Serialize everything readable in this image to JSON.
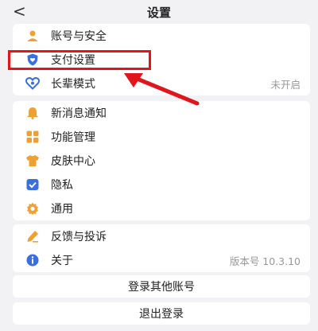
{
  "header": {
    "back_glyph": "<",
    "title": "设置"
  },
  "groups": [
    {
      "items": [
        {
          "name": "account-security",
          "icon": "person-icon",
          "label": "账号与安全",
          "value": ""
        },
        {
          "name": "payment-settings",
          "icon": "shield-heart-icon",
          "label": "支付设置",
          "value": ""
        },
        {
          "name": "elder-mode",
          "icon": "heart-link-icon",
          "label": "长辈模式",
          "value": "未开启"
        }
      ]
    },
    {
      "items": [
        {
          "name": "new-message-notify",
          "icon": "bell-icon",
          "label": "新消息通知",
          "value": ""
        },
        {
          "name": "feature-management",
          "icon": "grid-icon",
          "label": "功能管理",
          "value": ""
        },
        {
          "name": "skin-center",
          "icon": "shirt-icon",
          "label": "皮肤中心",
          "value": ""
        },
        {
          "name": "privacy",
          "icon": "shield-check-icon",
          "label": "隐私",
          "value": ""
        },
        {
          "name": "general",
          "icon": "gear-icon",
          "label": "通用",
          "value": ""
        }
      ]
    },
    {
      "items": [
        {
          "name": "feedback",
          "icon": "pen-icon",
          "label": "反馈与投诉",
          "value": ""
        },
        {
          "name": "about",
          "icon": "info-icon",
          "label": "关于",
          "value": "版本号 10.3.10"
        }
      ]
    }
  ],
  "buttons": {
    "login_other": "登录其他账号",
    "logout": "退出登录"
  },
  "colors": {
    "accent_blue": "#3a6fe0",
    "accent_orange": "#f0a032",
    "highlight_red": "#e0161c"
  }
}
